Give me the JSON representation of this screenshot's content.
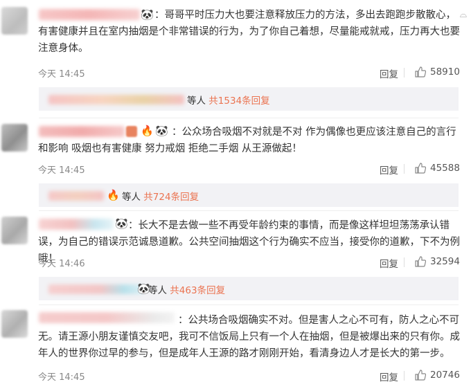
{
  "comments": [
    {
      "text": "：哥哥平时压力大也要注意释放压力的方法，多出去跑跑步散散心，有害健康并且在室内抽烟是个非常错误的行为，为了你自己着想，尽量能戒就戒，压力再大也要注意身体。",
      "time": "今天 14:45",
      "reply_label": "回复",
      "likes": "58910",
      "replies_summary": {
        "prefix": "等人",
        "count_text": "共1534条回复"
      }
    },
    {
      "text": "：公众场合吸烟不对就是不对 作为偶像也更应该注意自己的言行和影响 吸烟也有害健康 努力戒烟 拒绝二手烟 从王源做起！",
      "time": "今天 14:45",
      "reply_label": "回复",
      "likes": "45588",
      "replies_summary": {
        "prefix": "等人",
        "count_text": "共724条回复"
      }
    },
    {
      "text": "：长大不是去做一些不再受年龄约束的事情，而是像这样坦坦荡荡承认错误，为自己的错误示范诚恳道歉。公共空间抽烟这个行为确实不应当，接受你的道歉，下不为例哦！",
      "time": "今天 14:46",
      "reply_label": "回复",
      "likes": "32594",
      "replies_summary": {
        "prefix": "等人",
        "count_text": "共463条回复"
      }
    },
    {
      "text": "：公共场合吸烟确实不对。但是害人之心不可有，防人之心不可无。请王源小朋友谨慎交友吧，我可不信饭局上只有一个人在抽烟，但是被爆出来的只有你。成年人的世界你过早的参与，但是成年人王源的路才刚刚开始，看清身边人才是长大的第一步。",
      "time": "今天 14:45",
      "reply_label": "回复",
      "likes": "20746"
    }
  ],
  "icons": {
    "like": "thumbs-up-icon",
    "panda": "panda-emoji-icon",
    "fire": "fire-badge-icon"
  },
  "colors": {
    "more_link": "#eb7350",
    "reply_bg": "#f2f2f5"
  }
}
